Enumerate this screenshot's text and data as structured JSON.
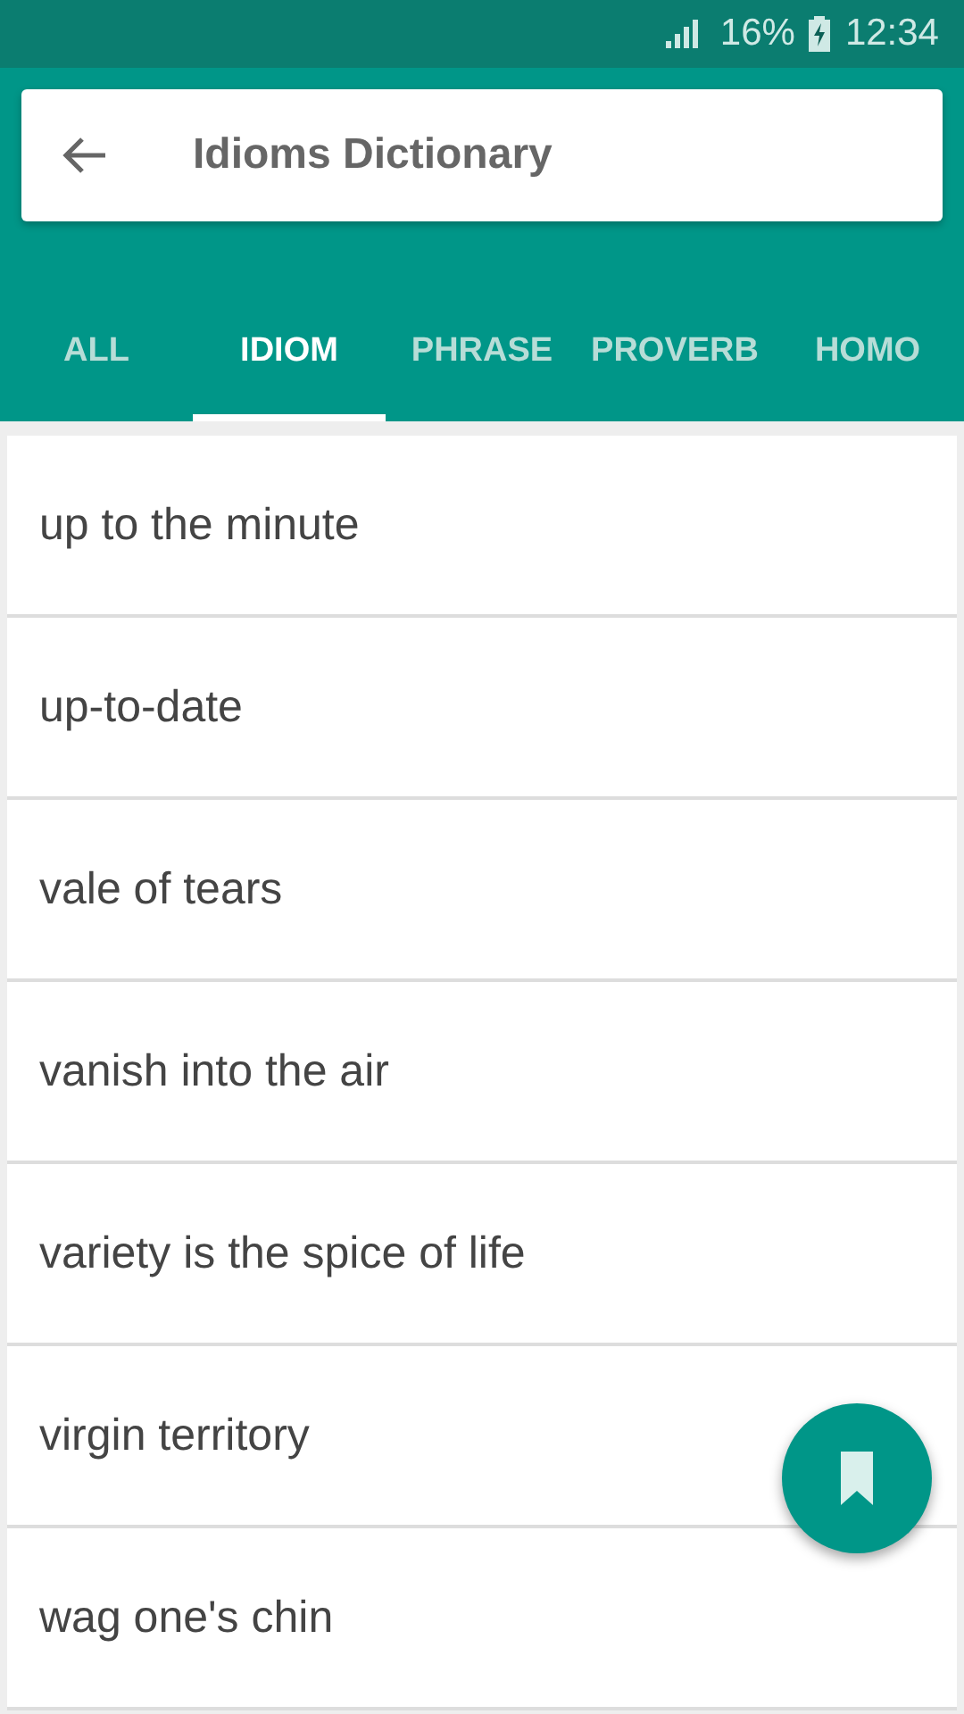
{
  "status_bar": {
    "battery": "16%",
    "time": "12:34"
  },
  "toolbar": {
    "title": "Idioms Dictionary"
  },
  "tabs": [
    {
      "label": "ALL",
      "selected": false
    },
    {
      "label": "IDIOM",
      "selected": true
    },
    {
      "label": "PHRASE",
      "selected": false
    },
    {
      "label": "PROVERB",
      "selected": false
    },
    {
      "label": "HOMO",
      "selected": false
    }
  ],
  "entries": [
    "up to the minute",
    "up-to-date",
    "vale of tears",
    "vanish into the air",
    "variety is the spice of life",
    "virgin territory",
    "wag one's chin"
  ]
}
